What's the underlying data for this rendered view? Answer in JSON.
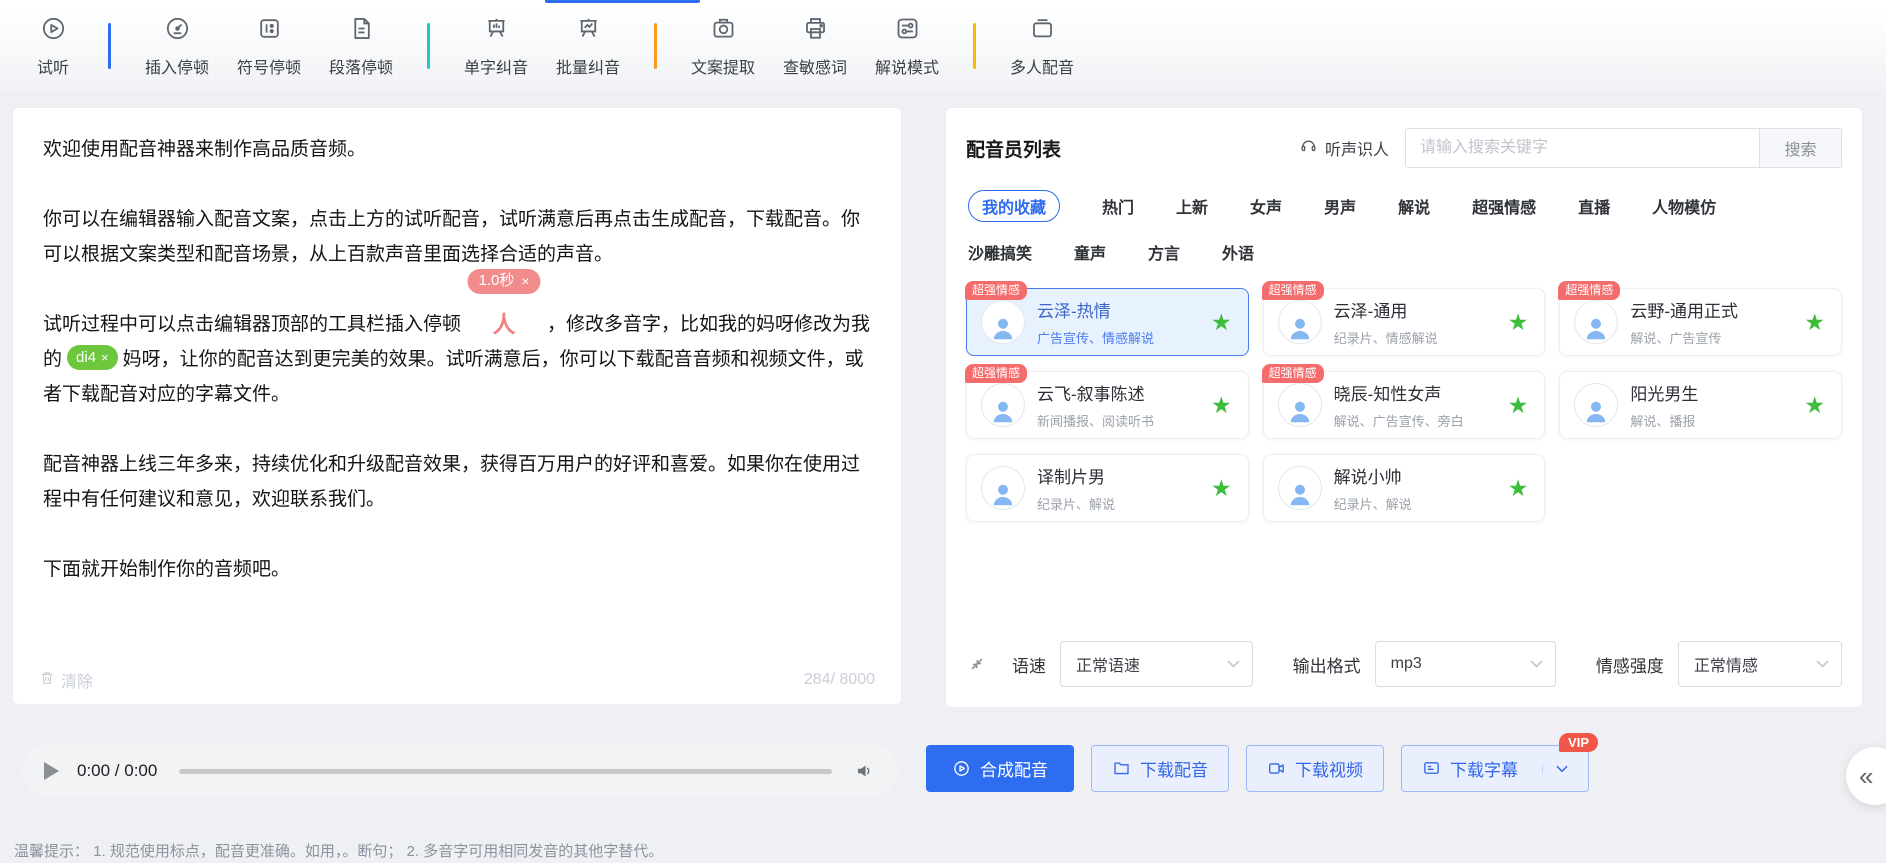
{
  "toolbar": {
    "items": [
      {
        "label": "试听"
      },
      {
        "label": "插入停顿"
      },
      {
        "label": "符号停顿"
      },
      {
        "label": "段落停顿"
      },
      {
        "label": "单字纠音"
      },
      {
        "label": "批量纠音"
      },
      {
        "label": "文案提取"
      },
      {
        "label": "查敏感词"
      },
      {
        "label": "解说模式"
      },
      {
        "label": "多人配音"
      }
    ]
  },
  "editor": {
    "p1": "欢迎使用配音神器来制作高品质音频。",
    "p2": "你可以在编辑器输入配音文案，点击上方的试听配音，试听满意后再点击生成配音，下载配音。你可以根据文案类型和配音场景，从上百款声音里面选择合适的声音。",
    "p3_before": "试听过程中可以点击编辑器顶部的工具栏插入停顿",
    "pause_label": "1.0秒",
    "pause_close": "×",
    "pause_glyph": "人",
    "p3_mid": "，修改多音字，比如我的妈呀修改为我的",
    "pinyin_label": "di4",
    "pinyin_close": "×",
    "p3_after": "妈呀，让你的配音达到更完美的效果。试听满意后，你可以下载配音音频和视频文件，或者下载配音对应的字幕文件。",
    "p4": "配音神器上线三年多来，持续优化和升级配音效果，获得百万用户的好评和喜爱。如果你在使用过程中有任何建议和意见，欢迎联系我们。",
    "p5": "下面就开始制作你的音频吧。",
    "clear_label": "清除",
    "char_count": "284/ 8000"
  },
  "player": {
    "time": "0:00 / 0:00"
  },
  "voices": {
    "title": "配音员列表",
    "listen_identify": "听声识人",
    "search_placeholder": "请输入搜索关键字",
    "search_button": "搜索",
    "tabs_row1": [
      "我的收藏",
      "热门",
      "上新",
      "女声",
      "男声",
      "解说",
      "超强情感",
      "直播",
      "人物模仿"
    ],
    "tabs_row2": [
      "沙雕搞笑",
      "童声",
      "方言",
      "外语"
    ],
    "cards": [
      {
        "name": "云泽-热情",
        "tags": "广告宣传、情感解说",
        "badge": "超强情感"
      },
      {
        "name": "云泽-通用",
        "tags": "纪录片、情感解说",
        "badge": "超强情感"
      },
      {
        "name": "云野-通用正式",
        "tags": "解说、广告宣传",
        "badge": "超强情感"
      },
      {
        "name": "云飞-叙事陈述",
        "tags": "新闻播报、阅读听书",
        "badge": "超强情感"
      },
      {
        "name": "晓辰-知性女声",
        "tags": "解说、广告宣传、旁白",
        "badge": "超强情感"
      },
      {
        "name": "阳光男生",
        "tags": "解说、播报"
      },
      {
        "name": "译制片男",
        "tags": "纪录片、解说"
      },
      {
        "name": "解说小帅",
        "tags": "纪录片、解说"
      }
    ],
    "star_glyph": "★",
    "speed_label": "语速",
    "speed_value": "正常语速",
    "format_label": "输出格式",
    "format_value": "mp3",
    "emotion_label": "情感强度",
    "emotion_value": "正常情感"
  },
  "actions": {
    "synthesize": "合成配音",
    "download_audio": "下载配音",
    "download_video": "下载视频",
    "download_subtitle": "下载字幕",
    "vip": "VIP",
    "collapse_glyph": "«"
  },
  "footer": {
    "hint": "温馨提示： 1. 规范使用标点，配音更准确。如用，。断句； 2. 多音字可用相同发音的其他字替代。"
  }
}
